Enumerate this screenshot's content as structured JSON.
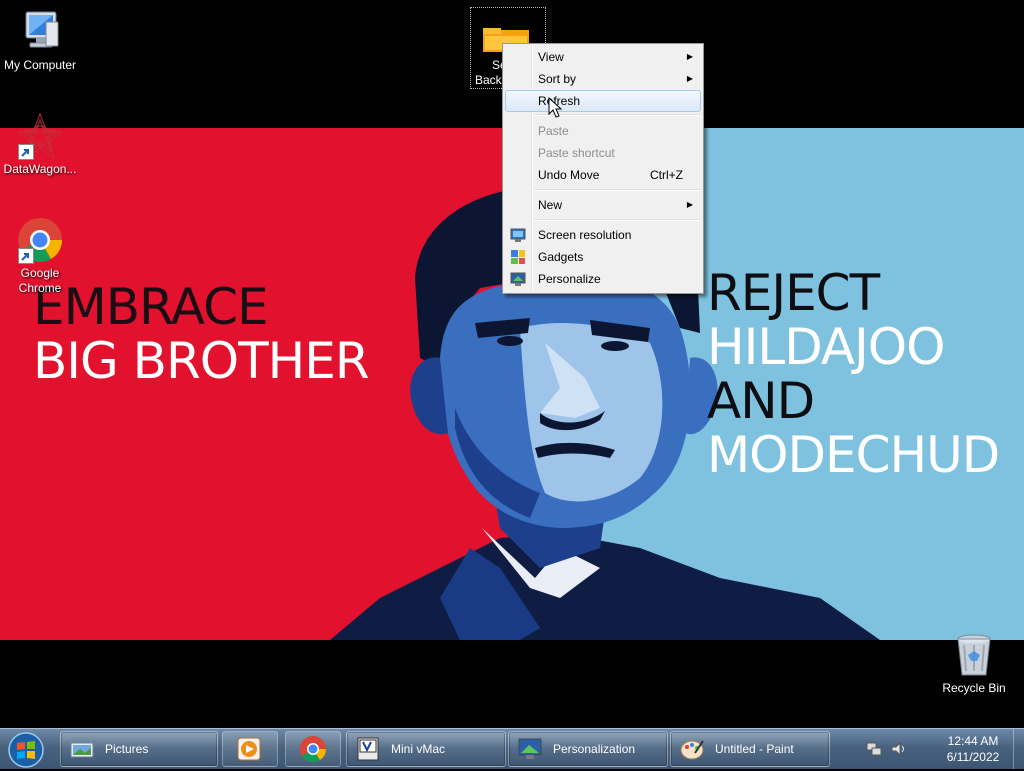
{
  "desktop_icons": {
    "my_computer": "My Computer",
    "datawagon": "DataWagon...",
    "chrome_line1": "Google",
    "chrome_line2": "Chrome",
    "recycle_bin": "Recycle Bin",
    "selected_folder_partial_1": "Se",
    "selected_folder_partial_2": "Backe"
  },
  "wallpaper": {
    "left_line1": "EMBRACE",
    "left_line2": "BIG BROTHER",
    "right_line1": "REJECT",
    "right_line2": "HILDAJOO",
    "right_line3": "AND",
    "right_line4": "MODECHUD"
  },
  "context_menu": {
    "view": "View",
    "sort_by": "Sort by",
    "refresh": "Refresh",
    "paste": "Paste",
    "paste_shortcut": "Paste shortcut",
    "undo_move": "Undo Move",
    "undo_move_shortcut": "Ctrl+Z",
    "new": "New",
    "screen_resolution": "Screen resolution",
    "gadgets": "Gadgets",
    "personalize": "Personalize"
  },
  "taskbar": {
    "pictures": "Pictures",
    "mini_vmac": "Mini vMac",
    "personalization": "Personalization",
    "paint": "Untitled - Paint",
    "time": "12:44 AM",
    "date": "6/11/2022"
  },
  "colors": {
    "wallpaper_red": "#e2122e",
    "wallpaper_blue": "#7fc2df",
    "taskbar": "#48627f"
  }
}
